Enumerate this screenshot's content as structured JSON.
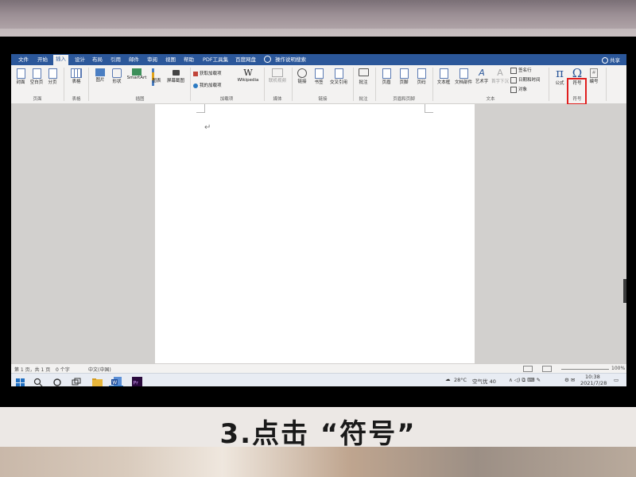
{
  "caption": "3.点击 “符号”",
  "ribbon_tabs": [
    "文件",
    "开始",
    "插入",
    "设计",
    "布局",
    "引用",
    "邮件",
    "审阅",
    "视图",
    "帮助",
    "PDF工具集",
    "百度网盘",
    "操作说明搜索"
  ],
  "active_tab": "插入",
  "share_label": "共享",
  "groups": {
    "pages": {
      "label": "页面",
      "items": [
        "封面",
        "空白页",
        "分页"
      ]
    },
    "tables": {
      "label": "表格",
      "items": [
        "表格"
      ]
    },
    "illustrations": {
      "label": "插图",
      "items": [
        "图片",
        "形状",
        "SmartArt",
        "图表",
        "屏幕截图"
      ]
    },
    "addins": {
      "label": "加载项",
      "items": [
        "获取加载项",
        "我的加载项",
        "Wikipedia"
      ]
    },
    "media": {
      "label": "媒体",
      "items": [
        "联机视频"
      ]
    },
    "links": {
      "label": "链接",
      "items": [
        "链接",
        "书签",
        "交叉引用"
      ]
    },
    "comments": {
      "label": "批注",
      "items": [
        "批注"
      ]
    },
    "header_footer": {
      "label": "页眉和页脚",
      "items": [
        "页眉",
        "页脚",
        "页码"
      ]
    },
    "text": {
      "label": "文本",
      "items": [
        "文本框",
        "文档部件",
        "艺术字",
        "首字下沉",
        "签名行",
        "日期和时间",
        "对象"
      ]
    },
    "symbols": {
      "label": "符号",
      "items": [
        "公式",
        "符号",
        "编号"
      ]
    }
  },
  "statusbar": {
    "page": "第 1 页，共 1 页",
    "words": "0 个字",
    "language": "中文(中国)",
    "zoom": "100%"
  },
  "tray": {
    "temperature": "28°C",
    "air": "空气优 40",
    "time": "10:38",
    "date": "2021/7/28"
  },
  "colors": {
    "ribbon_blue": "#2b579a",
    "highlight": "#e01e1e"
  }
}
